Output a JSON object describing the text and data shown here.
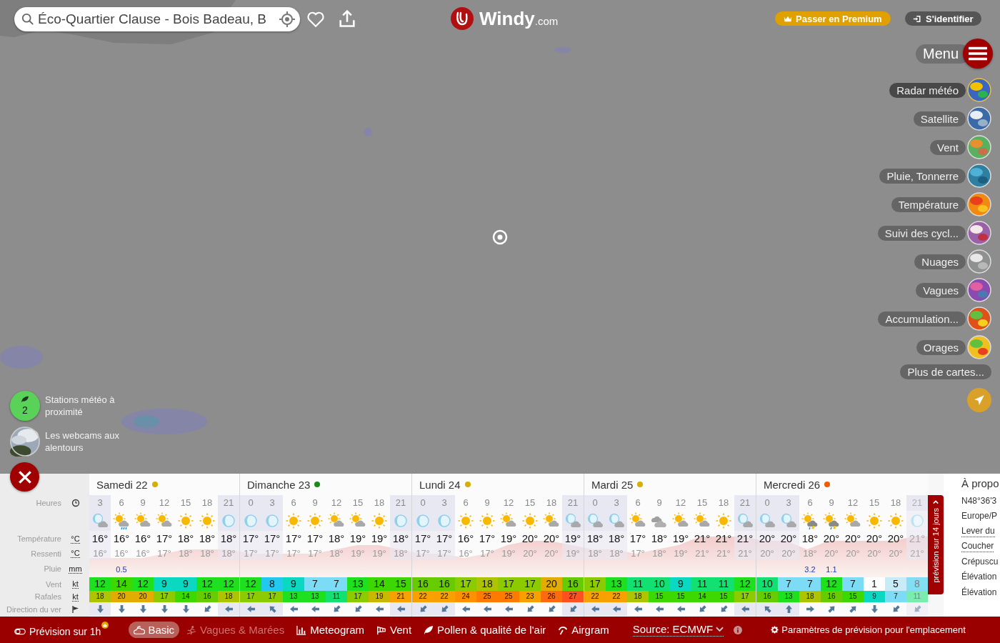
{
  "search": {
    "value": "Éco-Quartier Clause - Bois Badeau, B"
  },
  "logo": {
    "name": "Windy",
    "suffix": ".com"
  },
  "account": {
    "premium": "Passer en Premium",
    "login": "S'identifier"
  },
  "menu": {
    "label": "Menu"
  },
  "layers": [
    {
      "label": "Radar météo",
      "selected": true
    },
    {
      "label": "Satellite",
      "selected": false
    },
    {
      "label": "Vent",
      "selected": false
    },
    {
      "label": "Pluie, Tonnerre",
      "selected": false
    },
    {
      "label": "Température",
      "selected": false
    },
    {
      "label": "Suivi des cycl...",
      "selected": false
    },
    {
      "label": "Nuages",
      "selected": false
    },
    {
      "label": "Vagues",
      "selected": false
    },
    {
      "label": "Accumulation...",
      "selected": false
    },
    {
      "label": "Orages",
      "selected": false
    }
  ],
  "more_maps": "Plus de cartes...",
  "stations": {
    "count": "2",
    "label": "Stations météo à proximité"
  },
  "webcams": {
    "label": "Les webcams aux alentours"
  },
  "row_labels": [
    {
      "label": "Heures",
      "kind": "hour"
    },
    {
      "label": "Température",
      "unit": "°C",
      "kind": "temp"
    },
    {
      "label": "Ressenti",
      "unit": "°C",
      "kind": "feel"
    },
    {
      "label": "Pluie",
      "unit": "mm",
      "kind": "rain"
    },
    {
      "label": "Vent",
      "unit": "kt",
      "kind": "wind"
    },
    {
      "label": "Rafales",
      "unit": "kt",
      "kind": "gust"
    },
    {
      "label": "Direction du ver",
      "kind": "dir"
    }
  ],
  "days": [
    {
      "name": "Samedi 22",
      "color": "#d4b000",
      "columns": [
        {
          "hour": "3",
          "night": true,
          "sky": {
            "kind": "moon-cloud"
          },
          "temp": "16°",
          "feel": "16°",
          "wind": "12",
          "gust": "18",
          "arrow": {
            "kind": "down"
          },
          "dim": false
        },
        {
          "hour": "6",
          "night": false,
          "sky": {
            "kind": "sun-rain"
          },
          "temp": "16°",
          "feel": "16°",
          "rain": "0.5",
          "wind": "14",
          "gust": "20",
          "arrow": {
            "kind": "down"
          },
          "dim": false
        },
        {
          "hour": "9",
          "night": false,
          "sky": {
            "kind": "sun-cloud"
          },
          "temp": "16°",
          "feel": "16°",
          "wind": "12",
          "gust": "20",
          "arrow": {
            "kind": "down"
          },
          "dim": false
        },
        {
          "hour": "12",
          "night": false,
          "sky": {
            "kind": "sun-cloud"
          },
          "temp": "17°",
          "feel": "17°",
          "wind": "9",
          "gust": "17",
          "arrow": {
            "kind": "down"
          },
          "dim": false
        },
        {
          "hour": "15",
          "night": false,
          "sky": {
            "kind": "sun"
          },
          "temp": "18°",
          "feel": "18°",
          "wind": "9",
          "gust": "14",
          "arrow": {
            "kind": "down"
          },
          "dim": false
        },
        {
          "hour": "18",
          "night": false,
          "sky": {
            "kind": "sun"
          },
          "temp": "18°",
          "feel": "18°",
          "wind": "12",
          "gust": "16",
          "arrow": {
            "kind": "down-left"
          },
          "dim": false
        },
        {
          "hour": "21",
          "night": true,
          "sky": {
            "kind": "moon"
          },
          "temp": "18°",
          "feel": "18°",
          "wind": "12",
          "gust": "18",
          "arrow": {
            "kind": "left"
          },
          "dim": false
        }
      ]
    },
    {
      "name": "Dimanche 23",
      "color": "#1a8a1a",
      "columns": [
        {
          "hour": "0",
          "night": true,
          "sky": {
            "kind": "moon"
          },
          "temp": "17°",
          "feel": "17°",
          "wind": "12",
          "gust": "17",
          "arrow": {
            "kind": "left"
          },
          "dim": false
        },
        {
          "hour": "3",
          "night": true,
          "sky": {
            "kind": "moon"
          },
          "temp": "17°",
          "feel": "17°",
          "wind": "8",
          "gust": "17",
          "arrow": {
            "kind": "up-left"
          },
          "dim": false
        },
        {
          "hour": "6",
          "night": false,
          "sky": {
            "kind": "sun"
          },
          "temp": "17°",
          "feel": "17°",
          "wind": "9",
          "gust": "13",
          "arrow": {
            "kind": "left"
          },
          "dim": false
        },
        {
          "hour": "9",
          "night": false,
          "sky": {
            "kind": "sun"
          },
          "temp": "17°",
          "feel": "17°",
          "wind": "7",
          "gust": "13",
          "arrow": {
            "kind": "left"
          },
          "dim": false
        },
        {
          "hour": "12",
          "night": false,
          "sky": {
            "kind": "sun-cloud"
          },
          "temp": "18°",
          "feel": "18°",
          "wind": "7",
          "gust": "11",
          "arrow": {
            "kind": "down-left"
          },
          "dim": false
        },
        {
          "hour": "15",
          "night": false,
          "sky": {
            "kind": "sun-cloud"
          },
          "temp": "19°",
          "feel": "19°",
          "wind": "13",
          "gust": "17",
          "arrow": {
            "kind": "down-left"
          },
          "dim": false
        },
        {
          "hour": "18",
          "night": false,
          "sky": {
            "kind": "sun"
          },
          "temp": "19°",
          "feel": "19°",
          "wind": "14",
          "gust": "19",
          "arrow": {
            "kind": "left"
          },
          "dim": false
        },
        {
          "hour": "21",
          "night": true,
          "sky": {
            "kind": "moon"
          },
          "temp": "18°",
          "feel": "18°",
          "wind": "15",
          "gust": "21",
          "arrow": {
            "kind": "left"
          },
          "dim": false
        }
      ]
    },
    {
      "name": "Lundi 24",
      "color": "#d4b000",
      "columns": [
        {
          "hour": "0",
          "night": true,
          "sky": {
            "kind": "moon"
          },
          "temp": "17°",
          "feel": "17°",
          "wind": "16",
          "gust": "22",
          "arrow": {
            "kind": "down-left"
          },
          "dim": false
        },
        {
          "hour": "3",
          "night": true,
          "sky": {
            "kind": "moon"
          },
          "temp": "17°",
          "feel": "17°",
          "wind": "16",
          "gust": "22",
          "arrow": {
            "kind": "down-left"
          },
          "dim": false
        },
        {
          "hour": "6",
          "night": false,
          "sky": {
            "kind": "sun"
          },
          "temp": "16°",
          "feel": "16°",
          "wind": "17",
          "gust": "24",
          "arrow": {
            "kind": "left"
          },
          "dim": false
        },
        {
          "hour": "9",
          "night": false,
          "sky": {
            "kind": "sun"
          },
          "temp": "17°",
          "feel": "17°",
          "wind": "18",
          "gust": "25",
          "arrow": {
            "kind": "left"
          },
          "dim": false
        },
        {
          "hour": "12",
          "night": false,
          "sky": {
            "kind": "sun-cloud"
          },
          "temp": "19°",
          "feel": "19°",
          "wind": "17",
          "gust": "25",
          "arrow": {
            "kind": "left"
          },
          "dim": false
        },
        {
          "hour": "15",
          "night": false,
          "sky": {
            "kind": "sun"
          },
          "temp": "20°",
          "feel": "20°",
          "wind": "17",
          "gust": "23",
          "arrow": {
            "kind": "down-left"
          },
          "dim": false
        },
        {
          "hour": "18",
          "night": false,
          "sky": {
            "kind": "sun-cloud"
          },
          "temp": "20°",
          "feel": "20°",
          "wind": "20",
          "gust": "26",
          "arrow": {
            "kind": "down-left"
          },
          "dim": false
        },
        {
          "hour": "21",
          "night": true,
          "sky": {
            "kind": "moon-cloud"
          },
          "temp": "19°",
          "feel": "19°",
          "wind": "16",
          "gust": "27",
          "arrow": {
            "kind": "down-left"
          },
          "dim": false
        }
      ]
    },
    {
      "name": "Mardi 25",
      "color": "#d4b000",
      "columns": [
        {
          "hour": "0",
          "night": true,
          "sky": {
            "kind": "moon-cloud"
          },
          "temp": "18°",
          "feel": "18°",
          "wind": "17",
          "gust": "22",
          "arrow": {
            "kind": "left"
          },
          "dim": false
        },
        {
          "hour": "3",
          "night": true,
          "sky": {
            "kind": "moon-cloud"
          },
          "temp": "18°",
          "feel": "18°",
          "wind": "13",
          "gust": "22",
          "arrow": {
            "kind": "left"
          },
          "dim": false
        },
        {
          "hour": "6",
          "night": false,
          "sky": {
            "kind": "sun-cloud"
          },
          "temp": "17°",
          "feel": "17°",
          "wind": "11",
          "gust": "18",
          "arrow": {
            "kind": "left"
          },
          "dim": false
        },
        {
          "hour": "9",
          "night": false,
          "sky": {
            "kind": "cloud"
          },
          "temp": "18°",
          "feel": "18°",
          "wind": "10",
          "gust": "15",
          "arrow": {
            "kind": "left"
          },
          "dim": false
        },
        {
          "hour": "12",
          "night": false,
          "sky": {
            "kind": "sun-cloud"
          },
          "temp": "19°",
          "feel": "19°",
          "wind": "9",
          "gust": "15",
          "arrow": {
            "kind": "left"
          },
          "dim": false
        },
        {
          "hour": "15",
          "night": false,
          "sky": {
            "kind": "sun-cloud"
          },
          "temp": "21°",
          "feel": "21°",
          "wind": "11",
          "gust": "14",
          "arrow": {
            "kind": "down-left"
          },
          "dim": false
        },
        {
          "hour": "18",
          "night": false,
          "sky": {
            "kind": "sun"
          },
          "temp": "21°",
          "feel": "21°",
          "wind": "11",
          "gust": "15",
          "arrow": {
            "kind": "down-left"
          },
          "dim": false
        },
        {
          "hour": "21",
          "night": true,
          "sky": {
            "kind": "moon-cloud"
          },
          "temp": "21°",
          "feel": "21°",
          "wind": "12",
          "gust": "17",
          "arrow": {
            "kind": "left"
          },
          "dim": false
        }
      ]
    },
    {
      "name": "Mercredi 26",
      "color": "#f05a00",
      "columns": [
        {
          "hour": "0",
          "night": true,
          "sky": {
            "kind": "moon-cloud"
          },
          "temp": "20°",
          "feel": "20°",
          "wind": "10",
          "gust": "16",
          "arrow": {
            "kind": "up-left"
          },
          "dim": false
        },
        {
          "hour": "3",
          "night": true,
          "sky": {
            "kind": "moon-cloud"
          },
          "temp": "20°",
          "feel": "20°",
          "wind": "7",
          "gust": "13",
          "arrow": {
            "kind": "up"
          },
          "dim": false
        },
        {
          "hour": "6",
          "night": false,
          "sky": {
            "kind": "sun-thunder"
          },
          "temp": "18°",
          "feel": "18°",
          "rain": "3.2",
          "wind": "7",
          "gust": "18",
          "arrow": {
            "kind": "right"
          },
          "dim": false
        },
        {
          "hour": "9",
          "night": false,
          "sky": {
            "kind": "sun-thunder"
          },
          "temp": "20°",
          "feel": "20°",
          "rain": "1.1",
          "wind": "12",
          "gust": "16",
          "arrow": {
            "kind": "up-right"
          },
          "dim": false
        },
        {
          "hour": "12",
          "night": false,
          "sky": {
            "kind": "sun-cloud"
          },
          "temp": "20°",
          "feel": "20°",
          "wind": "7",
          "gust": "15",
          "arrow": {
            "kind": "up-right"
          },
          "dim": false
        },
        {
          "hour": "15",
          "night": false,
          "sky": {
            "kind": "sun"
          },
          "temp": "20°",
          "feel": "20°",
          "wind": "1",
          "gust": "9",
          "arrow": {
            "kind": "down"
          },
          "dim": false
        },
        {
          "hour": "18",
          "night": false,
          "sky": {
            "kind": "sun"
          },
          "temp": "20°",
          "feel": "20°",
          "wind": "5",
          "gust": "7",
          "arrow": {
            "kind": "down-left"
          },
          "dim": false
        },
        {
          "hour": "21",
          "night": true,
          "sky": {
            "kind": "moon"
          },
          "temp": "21°",
          "feel": "21°",
          "wind": "8",
          "gust": "11",
          "arrow": {
            "kind": "down-left"
          },
          "dim": true
        }
      ]
    }
  ],
  "long_forecast_tab": "prévision sur 14 jours",
  "info": [
    {
      "text": "À propo",
      "kind": "title"
    },
    {
      "text": "N48°36'3",
      "kind": "plain"
    },
    {
      "text": "Europe/P",
      "kind": "plain"
    },
    {
      "text": "Lever du",
      "kind": "link"
    },
    {
      "text": "Coucher",
      "kind": "link"
    },
    {
      "text": "Crépuscu",
      "kind": "plain"
    },
    {
      "text": "Élévation",
      "kind": "plain"
    },
    {
      "text": "Élévation",
      "kind": "plain"
    }
  ],
  "bottom_bar": {
    "one_hour": "Prévision sur 1h",
    "tabs": [
      {
        "label": "Basic",
        "kind": "basic",
        "selected": true,
        "disabled": false
      },
      {
        "label": "Vagues & Marées",
        "kind": "waves",
        "selected": false,
        "disabled": true
      },
      {
        "label": "Meteogram",
        "kind": "meteogram",
        "selected": false,
        "disabled": false
      },
      {
        "label": "Vent",
        "kind": "wind",
        "selected": false,
        "disabled": false
      },
      {
        "label": "Pollen & qualité de l'air",
        "kind": "pollen",
        "selected": false,
        "disabled": false
      },
      {
        "label": "Airgram",
        "kind": "airgram",
        "selected": false,
        "disabled": false
      }
    ],
    "source": "Source: ECMWF",
    "settings": "Paramètres de prévision pour l'emplacement"
  }
}
